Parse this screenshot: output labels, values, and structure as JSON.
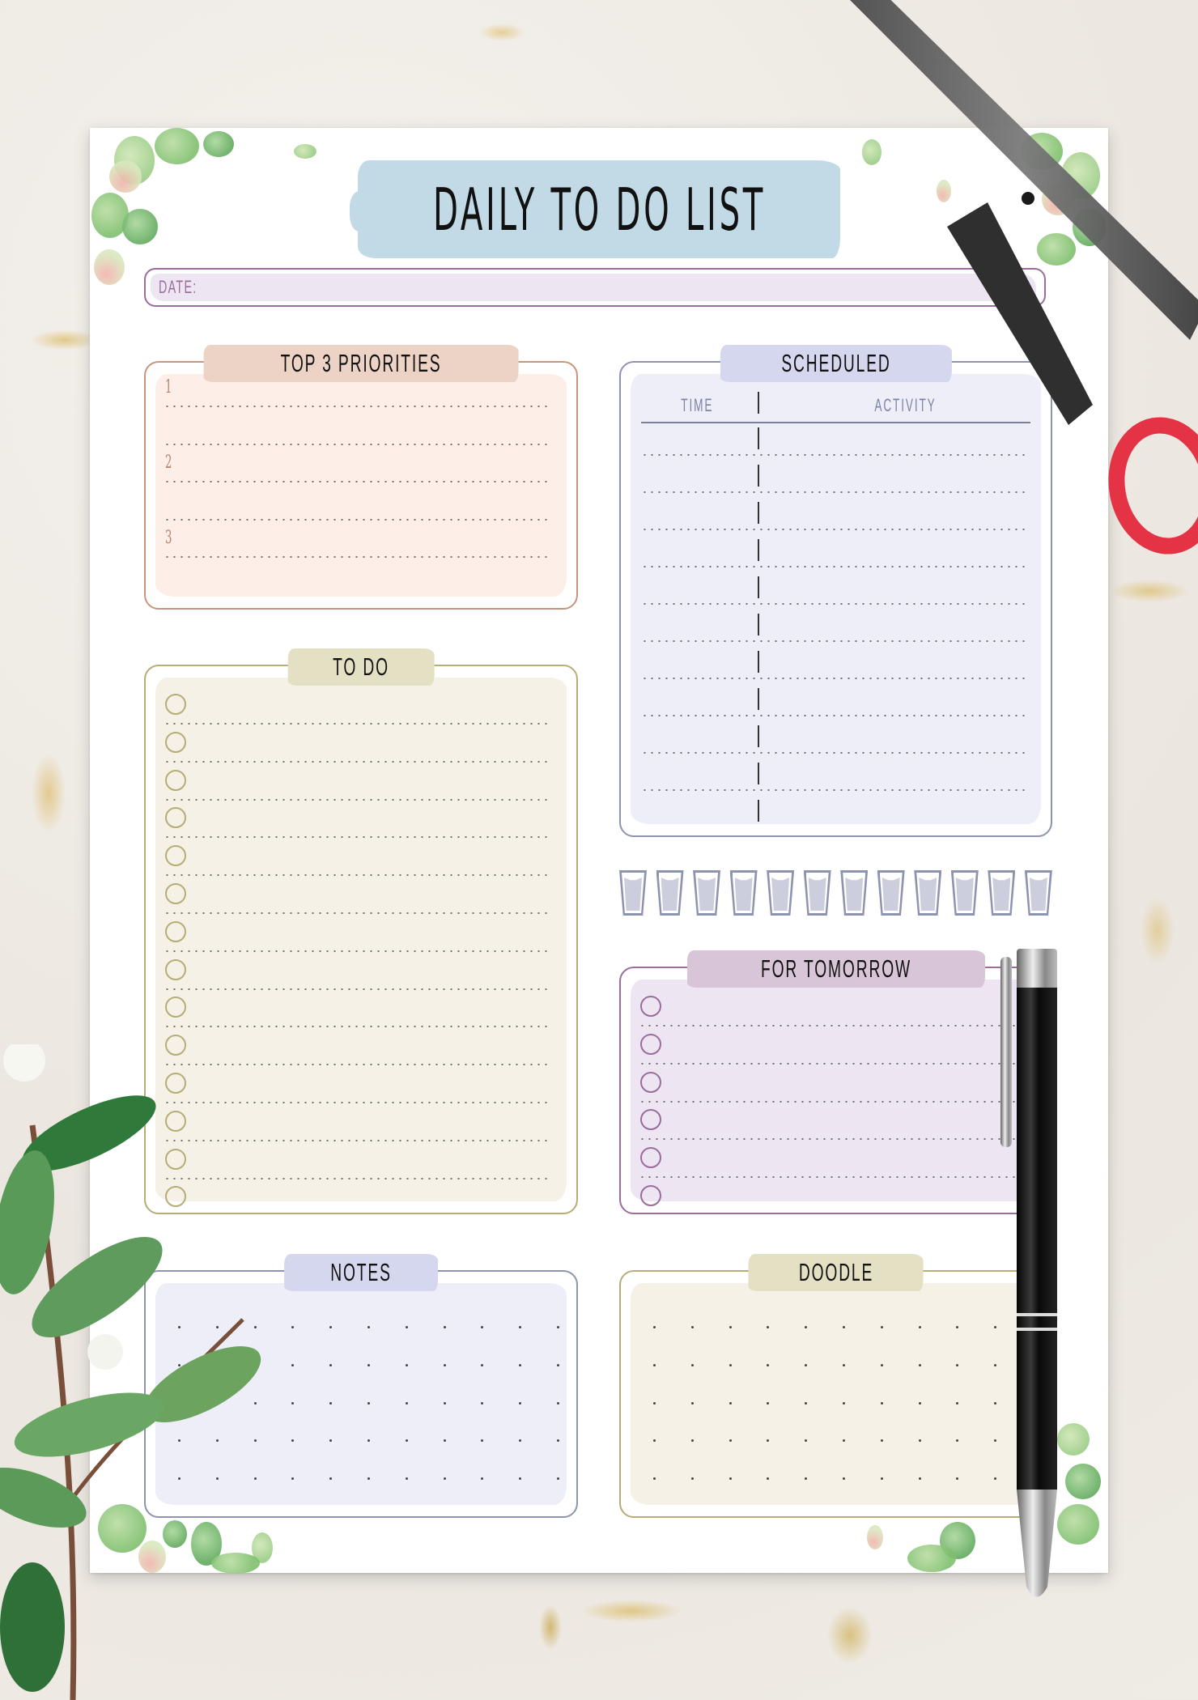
{
  "page": {
    "title": "DAILY TO DO LIST",
    "date_label": "DATE:",
    "date_value": ""
  },
  "sections": {
    "priorities": {
      "title": "TOP 3 PRIORITIES",
      "items": [
        {
          "number": "1",
          "text": ""
        },
        {
          "number": "2",
          "text": ""
        },
        {
          "number": "3",
          "text": ""
        }
      ]
    },
    "scheduled": {
      "title": "SCHEDULED",
      "columns": [
        "TIME",
        "ACTIVITY"
      ],
      "row_count": 10
    },
    "water_tracker": {
      "glasses_total": 12,
      "glasses_filled": 0
    },
    "todo": {
      "title": "TO DO",
      "item_count": 14
    },
    "for_tomorrow": {
      "title": "FOR TOMORROW",
      "item_count": 6
    },
    "notes": {
      "title": "NOTES",
      "content": ""
    },
    "doodle": {
      "title": "DOODLE"
    }
  },
  "colors": {
    "title_banner": "#c2dae6",
    "priorities_accent": "#c7957d",
    "priorities_fill": "#fdeee8",
    "scheduled_accent": "#8e93b0",
    "scheduled_fill": "#edeef8",
    "todo_accent": "#b6ad76",
    "todo_fill": "#f6f1e6",
    "tomorrow_accent": "#9a6d9c",
    "tomorrow_fill": "#ede5f2",
    "scissors_handle": "#e33344",
    "pen_body": "#141414"
  }
}
